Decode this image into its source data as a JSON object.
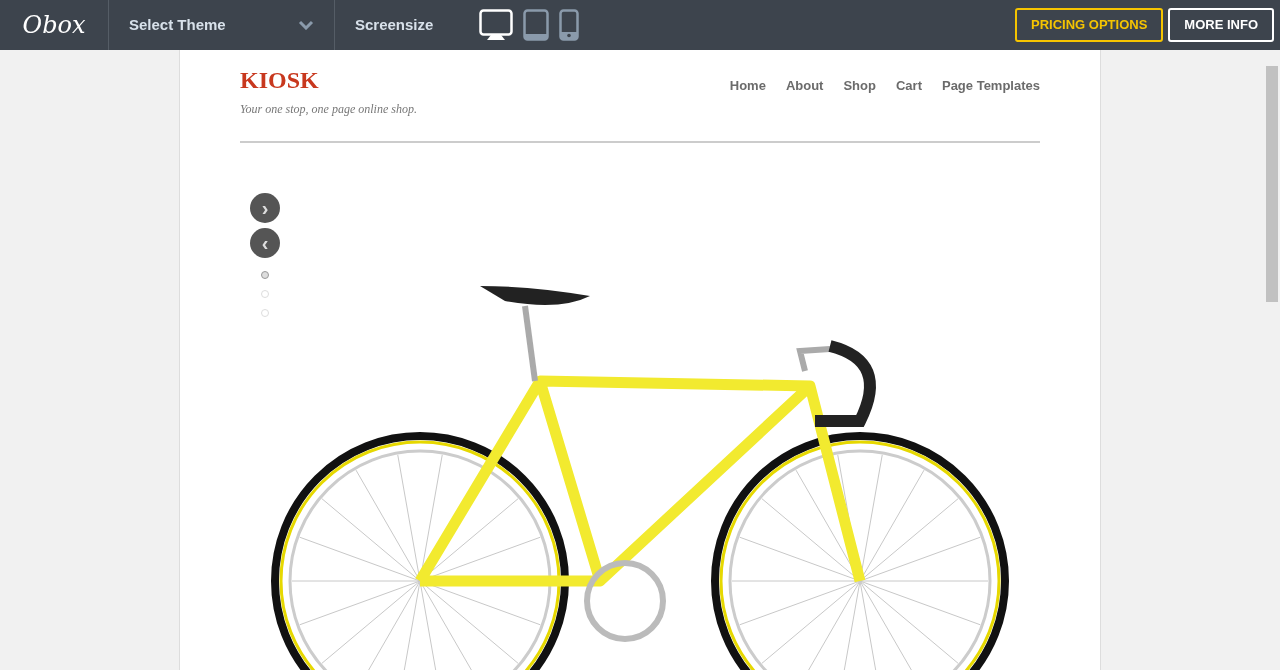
{
  "topbar": {
    "logo": "Obox",
    "theme_select": {
      "label": "Select Theme"
    },
    "screensize_label": "Screensize",
    "devices": [
      {
        "kind": "desktop",
        "selected": true
      },
      {
        "kind": "tablet",
        "selected": false
      },
      {
        "kind": "phone",
        "selected": false
      }
    ],
    "buttons": [
      {
        "label": "PRICING OPTIONS",
        "kind": "outline-accent"
      },
      {
        "label": "MORE INFO",
        "kind": "outline"
      }
    ]
  },
  "site": {
    "brand": "KIOSK",
    "tagline": "Your one stop, one page online shop.",
    "nav": [
      "Home",
      "About",
      "Shop",
      "Cart",
      "Page Templates"
    ],
    "slider": {
      "next": "›",
      "prev": "‹",
      "dots": [
        {
          "selected": true
        },
        {
          "selected": false
        },
        {
          "selected": false
        }
      ]
    }
  }
}
